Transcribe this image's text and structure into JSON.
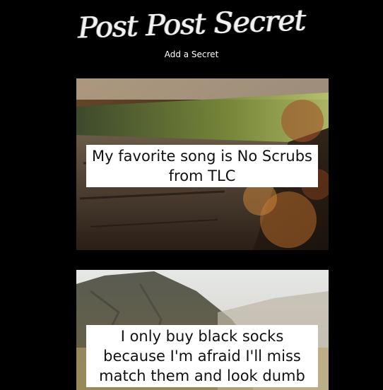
{
  "site": {
    "logo_text": "Post Post Secret",
    "add_link": "Add a Secret"
  },
  "posts": [
    {
      "text": "My favorite song is No Scrubs from TLC",
      "image": "mossy-log-with-autumn-leaves"
    },
    {
      "text": "I only buy black socks because I'm afraid I'll miss match them and look dumb",
      "image": "misty-mountain-cliff"
    }
  ]
}
